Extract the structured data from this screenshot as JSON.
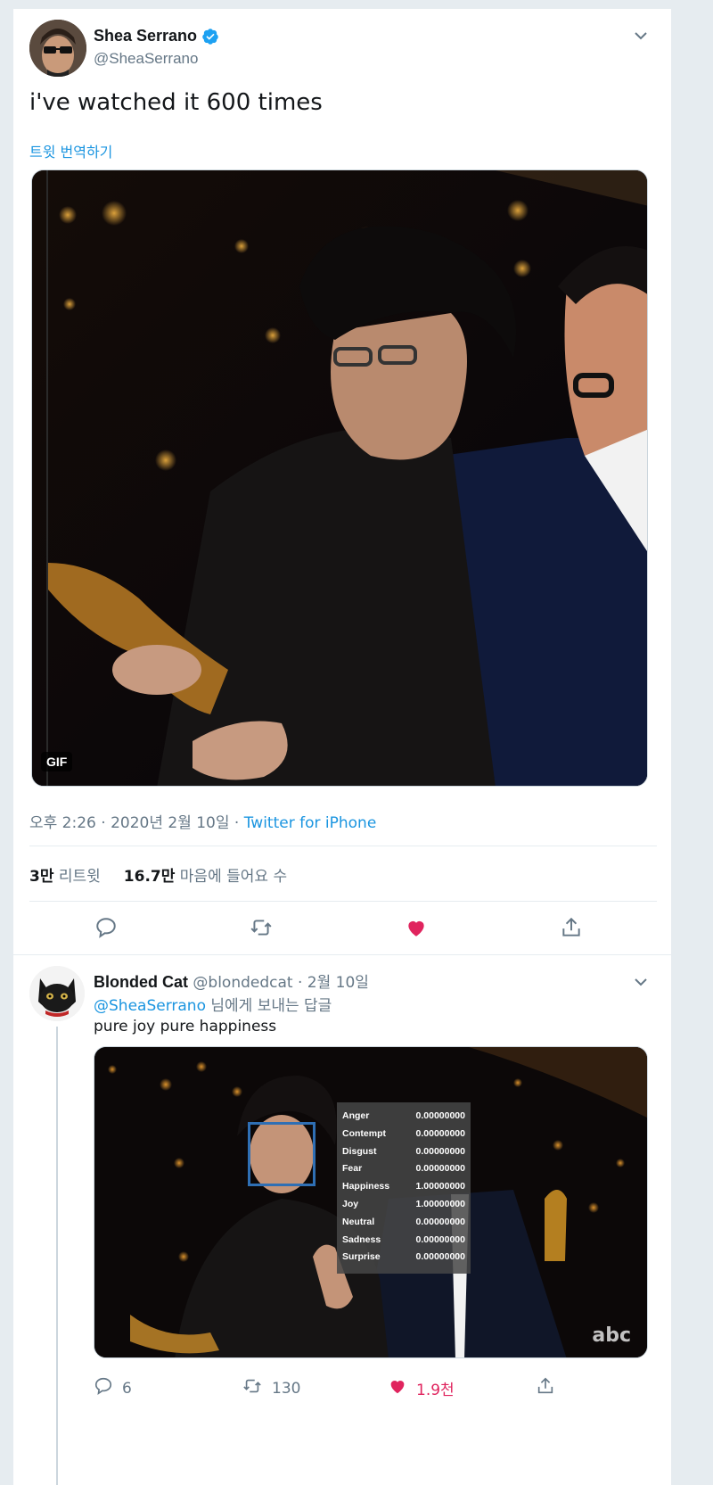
{
  "main_tweet": {
    "author_name": "Shea Serrano",
    "author_handle": "@SheaSerrano",
    "verified_icon": "verified-badge-icon",
    "text": "i've watched it 600 times",
    "translate_label": "트윗 번역하기",
    "media_badge": "GIF",
    "meta_time": "오후 2:26 · 2020년 2월 10일 · ",
    "meta_source": "Twitter for iPhone",
    "retweets_count": "3만",
    "retweets_label": "리트윗",
    "likes_count": "16.7만",
    "likes_label": "마음에 들어요 수",
    "liked": true,
    "colors": {
      "accent": "#1b95e0",
      "like": "#e0245e",
      "muted": "#657786"
    }
  },
  "reply": {
    "author_name": "Blonded Cat",
    "author_handle": "@blondedcat",
    "date": " · 2월 10일",
    "reply_to_mention": "@SheaSerrano",
    "reply_to_suffix": " 님에게 보내는 답글",
    "text": "pure joy pure happiness",
    "emotions": [
      {
        "label": "Anger",
        "value": "0.00000000"
      },
      {
        "label": "Contempt",
        "value": "0.00000000"
      },
      {
        "label": "Disgust",
        "value": "0.00000000"
      },
      {
        "label": "Fear",
        "value": "0.00000000"
      },
      {
        "label": "Happiness",
        "value": "1.00000000"
      },
      {
        "label": "Joy",
        "value": "1.00000000"
      },
      {
        "label": "Neutral",
        "value": "0.00000000"
      },
      {
        "label": "Sadness",
        "value": "0.00000000"
      },
      {
        "label": "Surprise",
        "value": "0.00000000"
      }
    ],
    "broadcast_logo": "abc",
    "replies_count": "6",
    "retweets_count": "130",
    "likes_count": "1.9천",
    "liked": true
  }
}
